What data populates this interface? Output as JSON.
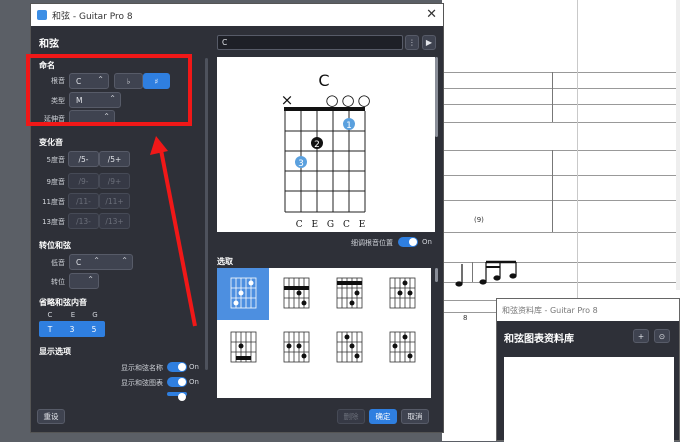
{
  "background_score": {
    "tab_marks": [
      "(9)",
      "8"
    ]
  },
  "dialog": {
    "window_title": "和弦 - Guitar Pro 8",
    "heading": "和弦",
    "search_value": "C",
    "name_section": {
      "title": "命名",
      "root_label": "根音",
      "root_value": "C",
      "flat_label": "♭",
      "sharp_label": "♯",
      "type_label": "类型",
      "type_value": "M",
      "extension_label": "延伸音",
      "extension_value": ""
    },
    "alterations": {
      "title": "变化音",
      "rows": [
        {
          "label": "5度音",
          "minus": "/5-",
          "plus": "/5+",
          "enabled": true
        },
        {
          "label": "9度音",
          "minus": "/9-",
          "plus": "/9+",
          "enabled": false
        },
        {
          "label": "11度音",
          "minus": "/11-",
          "plus": "/11+",
          "enabled": false
        },
        {
          "label": "13度音",
          "minus": "/13-",
          "plus": "/13+",
          "enabled": false
        }
      ]
    },
    "inversion": {
      "title": "转位和弦",
      "bass_label": "低音",
      "bass_value": "C",
      "inversion_label": "转位",
      "inversion_value": ""
    },
    "omitted": {
      "title": "省略和弦内音",
      "notes": [
        "C",
        "E",
        "G"
      ],
      "degrees": [
        "T",
        "3",
        "5"
      ]
    },
    "display": {
      "title": "显示选项",
      "show_name_label": "显示和弦名称",
      "show_name_state": "On",
      "show_diagram_label": "显示和弦图表",
      "show_diagram_state": "On"
    },
    "diagram": {
      "chord_name": "C",
      "open_marks": [
        "×",
        "○",
        "○",
        "○"
      ],
      "fingers": [
        "1",
        "2",
        "3"
      ],
      "string_notes": "C E G C E",
      "fine_tune_label": "细调根音位置",
      "fine_tune_state": "On"
    },
    "picks_title": "选取",
    "footer": {
      "reset": "重设",
      "delete": "删除",
      "ok": "确定",
      "cancel": "取消"
    },
    "colors": {
      "accent": "#2f7fe0",
      "annotation": "#f01818",
      "finger_blue": "#5aa0de"
    }
  },
  "library": {
    "window_title": "和弦资料库 - Guitar Pro 8",
    "heading": "和弦图表资料库"
  }
}
